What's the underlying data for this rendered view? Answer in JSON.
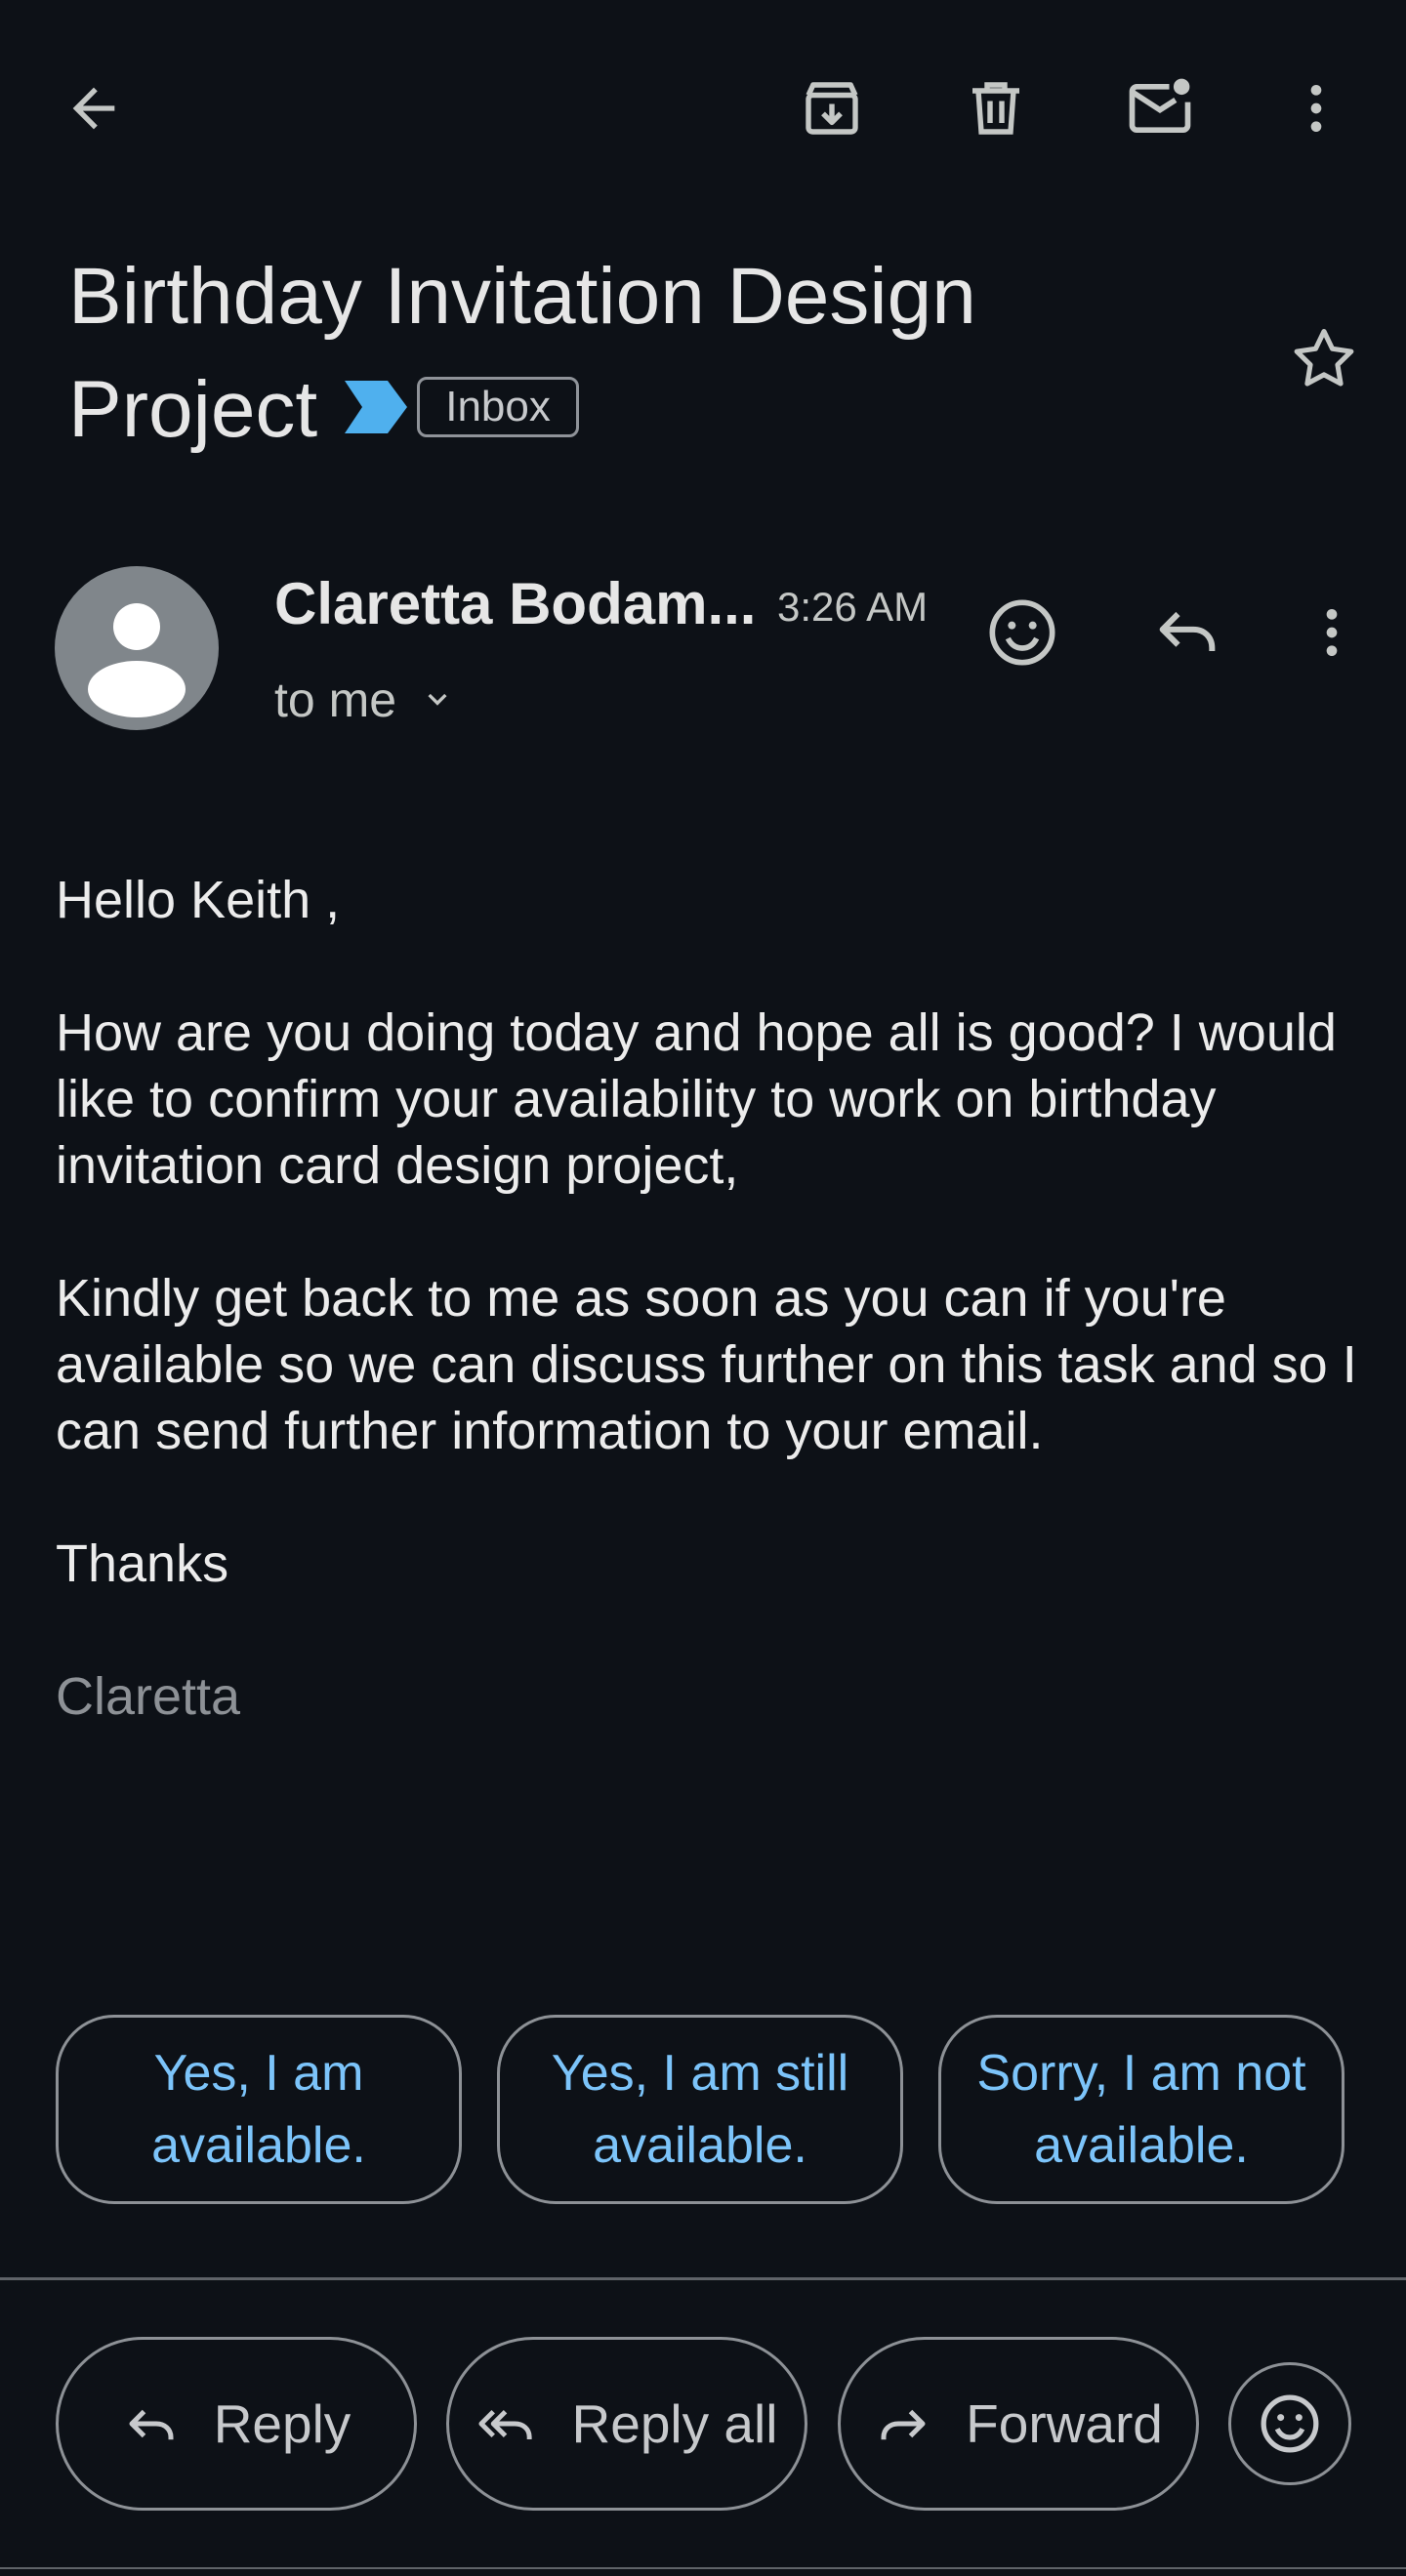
{
  "toolbar": {
    "back_icon": "arrow-left-icon",
    "archive_icon": "archive-icon",
    "delete_icon": "trash-icon",
    "mark_unread_icon": "mail-unread-icon",
    "more_icon": "more-vert-icon"
  },
  "subject": {
    "title": "Birthday Invitation Design Project",
    "label": "Inbox",
    "important_marker_color": "#4fb0ee",
    "star_icon": "star-outline-icon"
  },
  "message": {
    "sender": "Claretta Bodam...",
    "time": "3:26 AM",
    "recipient": "to me",
    "greeting": "Hello Keith ,",
    "paragraph1": "How are you doing today and hope all is good? I would like to confirm your availability to work on birthday invitation card design project,",
    "paragraph2": "Kindly get back to me as soon as you can if you're available so we can discuss further on this task and so I can send further information to your email.",
    "closing": "Thanks",
    "signature": "Claretta"
  },
  "smart_replies": [
    {
      "label": "Yes, I am available."
    },
    {
      "label": "Yes, I am still available."
    },
    {
      "label": "Sorry, I am not available."
    }
  ],
  "actions": {
    "reply": "Reply",
    "reply_all": "Reply all",
    "forward": "Forward"
  },
  "colors": {
    "background": "#0d1117",
    "accent": "#7cc4fa",
    "text": "#e3e3e3"
  }
}
